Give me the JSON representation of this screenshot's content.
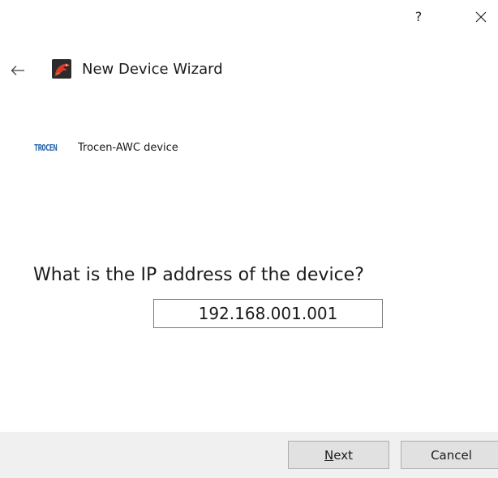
{
  "titlebar": {
    "help_label": "?",
    "close_icon": "close-icon"
  },
  "header": {
    "back_icon": "back-arrow-icon",
    "app_icon": "trocen-dragon-icon",
    "title": "New Device Wizard"
  },
  "device": {
    "logo_text": "TROCEN",
    "name": "Trocen-AWC device",
    "logo_color": "#1f5fa8"
  },
  "main": {
    "question": "What is the IP address of the device?",
    "ip_value": "192.168.001.001"
  },
  "footer": {
    "next_mnemonic": "N",
    "next_rest": "ext",
    "cancel_label": "Cancel"
  }
}
